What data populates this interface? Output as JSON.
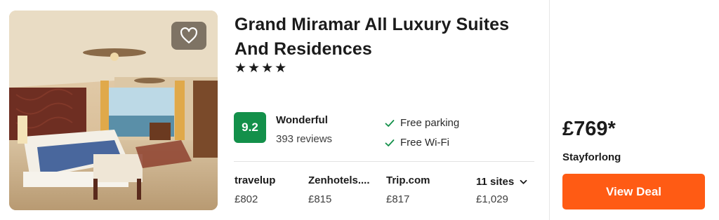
{
  "hotel": {
    "name": "Grand Miramar All Luxury Suites And Residences",
    "stars": "★★★★",
    "photo_alt": "hotel room photo"
  },
  "rating": {
    "score": "9.2",
    "label": "Wonderful",
    "reviews": "393 reviews",
    "badge_color": "#13904a"
  },
  "amenities": [
    "Free parking",
    "Free Wi-Fi"
  ],
  "offers": [
    {
      "site": "travelup",
      "price": "£802"
    },
    {
      "site": "Zenhotels....",
      "price": "£815"
    },
    {
      "site": "Trip.com",
      "price": "£817"
    },
    {
      "site": "11 sites",
      "price": "£1,029"
    }
  ],
  "deal": {
    "price": "£769*",
    "provider": "Stayforlong",
    "button_label": "View Deal",
    "button_color": "#ff5b14"
  },
  "icons": {
    "favorite": "heart-icon",
    "check": "check-icon",
    "expand": "chevron-down-icon"
  }
}
